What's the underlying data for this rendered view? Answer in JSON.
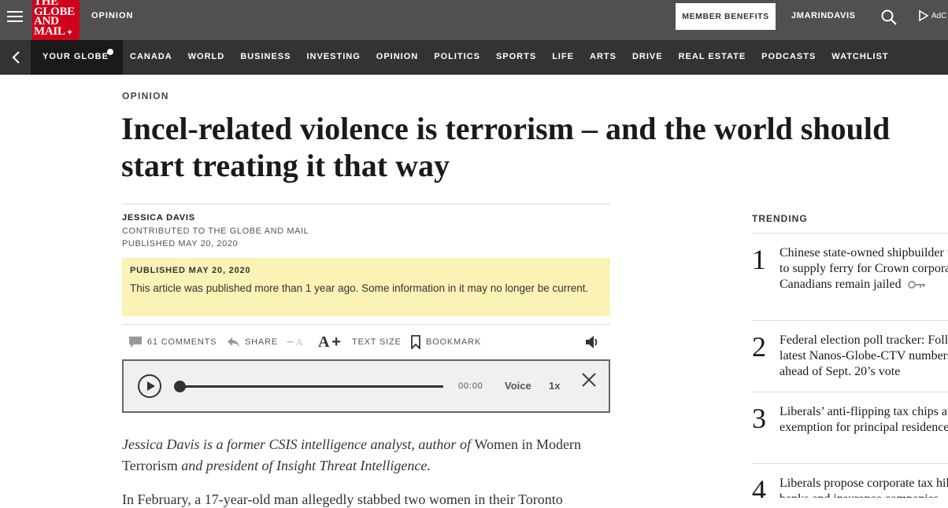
{
  "header": {
    "logo_lines": [
      "THE",
      "GLOBE",
      "AND",
      "MAIL"
    ],
    "section": "OPINION",
    "member_benefits": "MEMBER BENEFITS",
    "username": "JMARINDAVIS",
    "adchoices": "AdC"
  },
  "nav": {
    "your_globe": "YOUR GLOBE",
    "items": [
      "CANADA",
      "WORLD",
      "BUSINESS",
      "INVESTING",
      "OPINION",
      "POLITICS",
      "SPORTS",
      "LIFE",
      "ARTS",
      "DRIVE",
      "REAL ESTATE",
      "PODCASTS",
      "WATCHLIST"
    ]
  },
  "article": {
    "section": "OPINION",
    "headline": "Incel-related violence is terrorism – and the world should start treating it that way",
    "author": "JESSICA DAVIS",
    "contributed": "CONTRIBUTED TO THE GLOBE AND MAIL",
    "published": "PUBLISHED MAY 20, 2020",
    "notice_title": "PUBLISHED MAY 20, 2020",
    "notice_body": "This article was published more than 1 year ago. Some information in it may no longer be current.",
    "bio_parts": [
      {
        "text": "Jessica Davis is a former CSIS intelligence analyst, author of ",
        "italic": true
      },
      {
        "text": "Women in Modern Terrorism",
        "italic": false
      },
      {
        "text": " and president of Insight Threat Intelligence.",
        "italic": true
      }
    ],
    "next_paragraph": "In February, a 17-year-old man allegedly stabbed two women in their Toronto"
  },
  "tools": {
    "comments": "61 COMMENTS",
    "share": "SHARE",
    "text_size": "TEXT SIZE",
    "bookmark": "BOOKMARK"
  },
  "player": {
    "time": "00:00",
    "voice": "Voice",
    "speed": "1x",
    "progress": 0
  },
  "trending": {
    "title": "TRENDING",
    "items": [
      {
        "rank": "1",
        "text": "Chinese state-owned shipbuilder tapped to supply ferry for Crown corporation as Canadians remain jailed",
        "key": true
      },
      {
        "rank": "2",
        "text": "Federal election poll tracker: Follow the latest Nanos-Globe-CTV numbers ahead of Sept. 20’s vote",
        "key": false
      },
      {
        "rank": "3",
        "text": "Liberals’ anti-flipping tax chips away at exemption for principal residences",
        "key": true
      },
      {
        "rank": "4",
        "text": "Liberals propose corporate tax hike on banks and insurance companies",
        "key": false
      }
    ]
  },
  "colors": {
    "topbar": "#505050",
    "navbar": "#333333",
    "logo_red": "#d0021b",
    "notice_yellow": "#fbf3b5"
  }
}
